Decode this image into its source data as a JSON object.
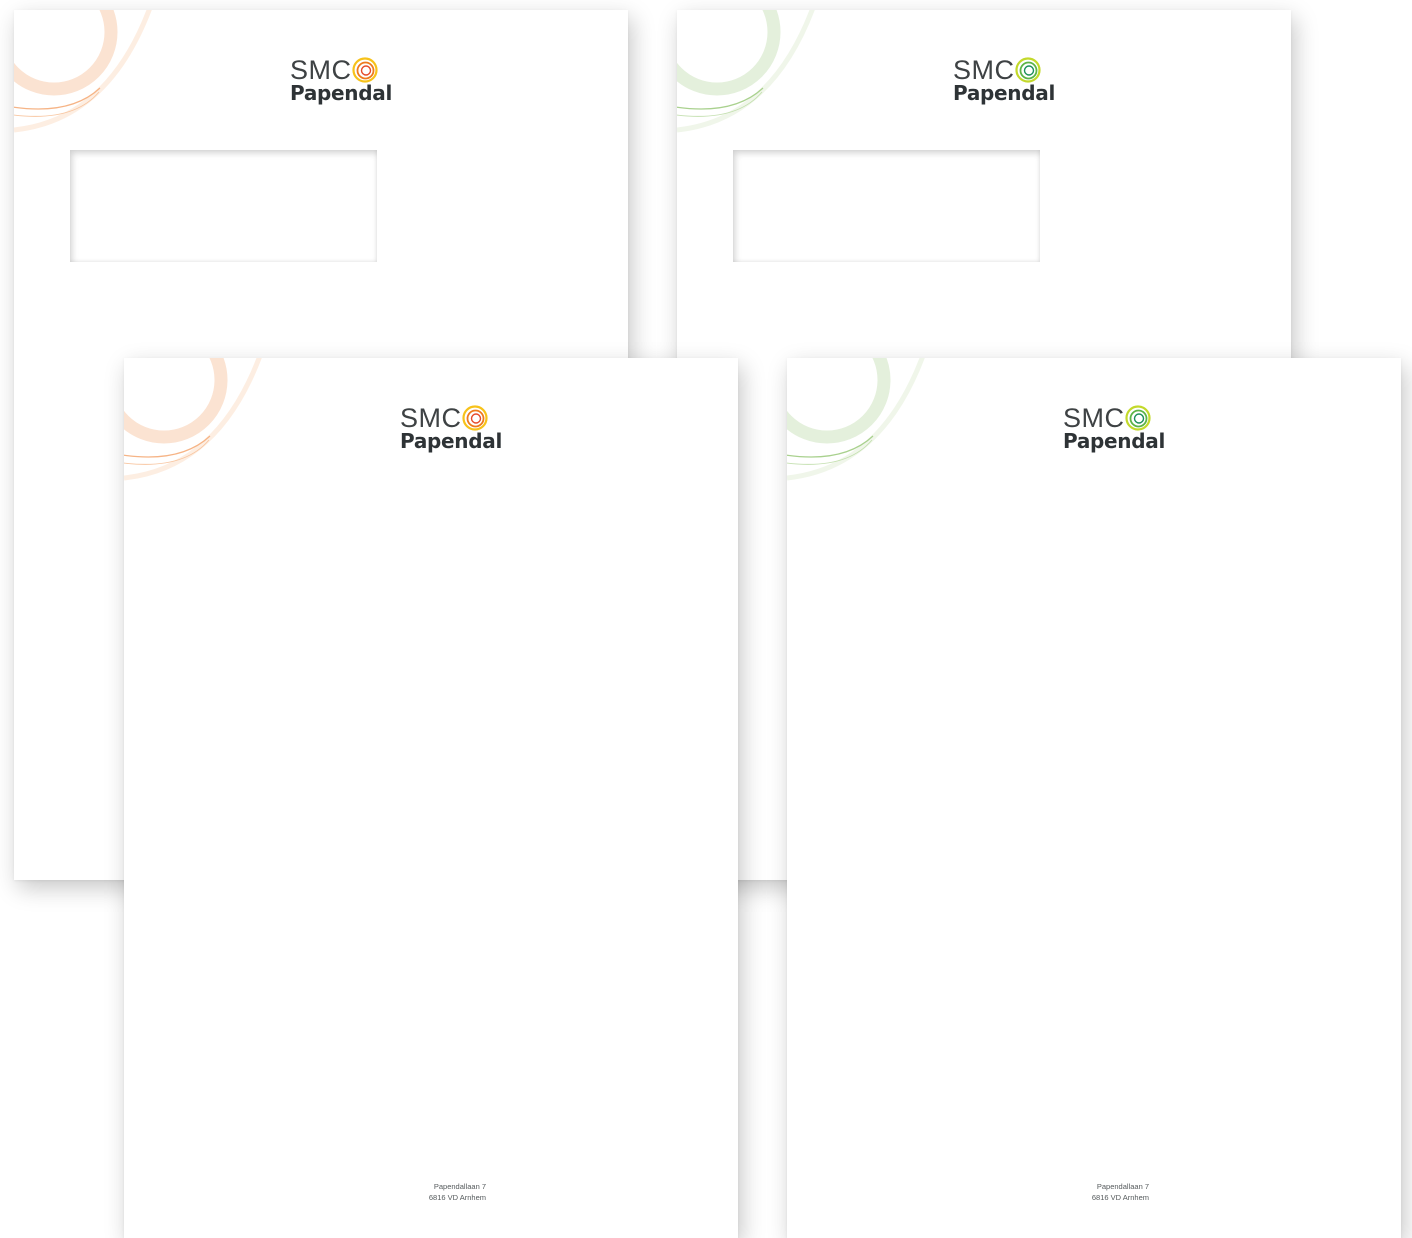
{
  "brand": {
    "logo_line1": "SMC",
    "logo_line2": "Papendal",
    "text_color": "#2e3336"
  },
  "variants": [
    {
      "color_name": "orange",
      "accent": "#f2a35e",
      "swirl_color": "#fbd8bd",
      "mark_colors": [
        "#f7c21a",
        "#ee7a1e",
        "#e54a2a"
      ]
    },
    {
      "color_name": "green",
      "accent": "#8cc46a",
      "swirl_color": "#d9ebcc",
      "mark_colors": [
        "#c3d92b",
        "#5cb446",
        "#1d8f5a"
      ]
    }
  ],
  "sheets": [
    {
      "kind": "envelope",
      "variant": "orange",
      "has_address_window": true
    },
    {
      "kind": "envelope",
      "variant": "green",
      "has_address_window": true
    },
    {
      "kind": "letterhead",
      "variant": "orange",
      "has_address_window": false
    },
    {
      "kind": "letterhead",
      "variant": "green",
      "has_address_window": false
    }
  ],
  "footer": {
    "line1": "Papendallaan 7",
    "line2": "6816 VD Arnhem"
  }
}
